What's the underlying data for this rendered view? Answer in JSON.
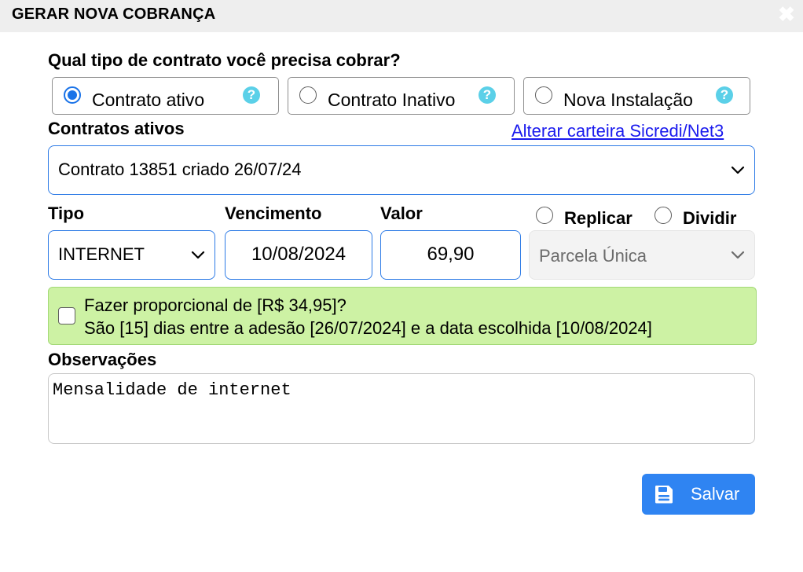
{
  "dialog": {
    "title": "GERAR NOVA COBRANÇA",
    "close_glyph": "✖"
  },
  "contract_type": {
    "question": "Qual tipo de contrato você precisa cobrar?",
    "options": [
      {
        "label": "Contrato ativo",
        "checked": true
      },
      {
        "label": "Contrato Inativo",
        "checked": false
      },
      {
        "label": "Nova Instalação",
        "checked": false
      }
    ],
    "help_glyph": "?"
  },
  "contracts": {
    "label": "Contratos ativos",
    "change_wallet_link": "Alterar carteira Sicredi/Net3",
    "selected": "Contrato 13851 criado 26/07/24"
  },
  "billing": {
    "tipo_label": "Tipo",
    "tipo_value": "INTERNET",
    "vencimento_label": "Vencimento",
    "vencimento_value": "10/08/2024",
    "valor_label": "Valor",
    "valor_value": "69,90",
    "replicar_label": "Replicar",
    "dividir_label": "Dividir",
    "parcela_value": "Parcela Única"
  },
  "proporcional": {
    "line1": "Fazer proporcional de [R$ 34,95]?",
    "line2": "São [15] dias entre a adesão [26/07/2024] e a data escolhida [10/08/2024]",
    "checked": false
  },
  "observacoes": {
    "label": "Observações",
    "value": "Mensalidade de internet"
  },
  "actions": {
    "save_label": "Salvar"
  },
  "colors": {
    "accent": "#2f84f2",
    "help": "#5bd0e8",
    "proporcional_bg": "#cdf2a4",
    "link": "#1a1aee"
  },
  "icons": {
    "close": "close-icon",
    "help": "help-icon",
    "chevron": "chevron-down-icon",
    "save": "floppy-disk-icon"
  }
}
